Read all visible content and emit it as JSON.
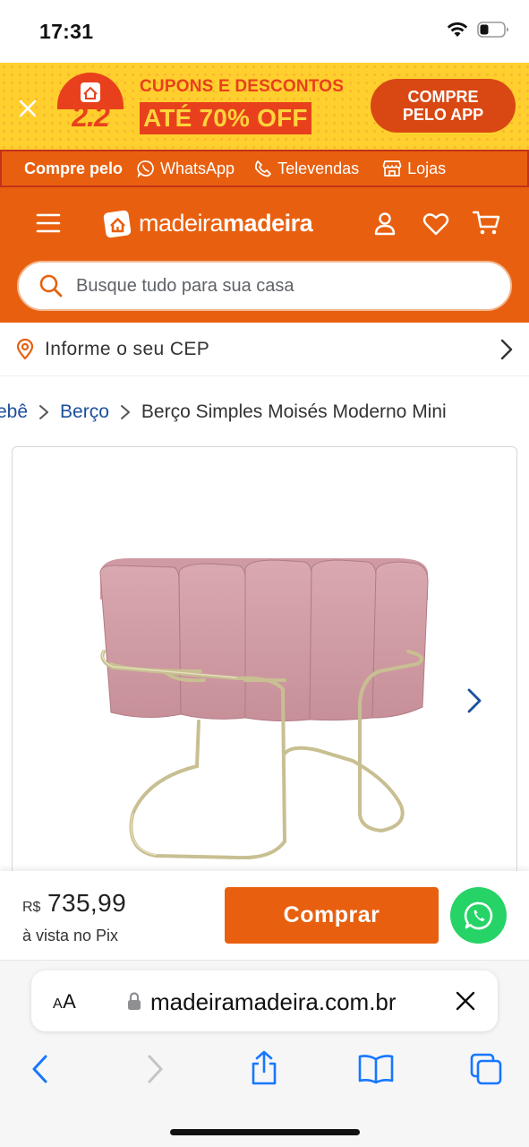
{
  "status_bar": {
    "time": "17:31",
    "icons": [
      "wifi-icon",
      "battery-icon"
    ]
  },
  "promo": {
    "badge_text": "2.2",
    "line1": "CUPONS E DESCONTOS",
    "line2": "ATÉ 70% OFF",
    "button_label": "COMPRE PELO APP",
    "colors": {
      "background": "#ffcf2e",
      "accent": "#e8401c"
    }
  },
  "contact_bar": {
    "lead": "Compre pelo",
    "items": [
      {
        "label": "WhatsApp",
        "icon": "whatsapp-icon"
      },
      {
        "label": "Televendas",
        "icon": "phone-icon"
      },
      {
        "label": "Lojas",
        "icon": "store-icon"
      }
    ]
  },
  "header": {
    "logo_light": "madeira",
    "logo_bold": "madeira",
    "icons": [
      "menu-icon",
      "user-icon",
      "heart-icon",
      "cart-icon"
    ],
    "brand_color": "#e8600f",
    "search": {
      "placeholder": "Busque tudo para sua casa",
      "value": ""
    }
  },
  "cep": {
    "label": "Informe o seu CEP"
  },
  "breadcrumb": {
    "items": [
      "ebê",
      "Berço"
    ],
    "current": "Berço Simples Moisés Moderno Mini"
  },
  "product": {
    "image_icon": "bassinet-product-image",
    "next_icon": "chevron-right-icon"
  },
  "buy_bar": {
    "currency": "R$",
    "price": "735,99",
    "price_note": "à vista no Pix",
    "buy_label": "Comprar",
    "whatsapp_color": "#25d366"
  },
  "safari": {
    "aa_small": "A",
    "aa_large": "A",
    "url": "madeiramadeira.com.br",
    "nav_icons": [
      "back-icon",
      "forward-icon",
      "share-icon",
      "bookmarks-icon",
      "tabs-icon"
    ]
  }
}
